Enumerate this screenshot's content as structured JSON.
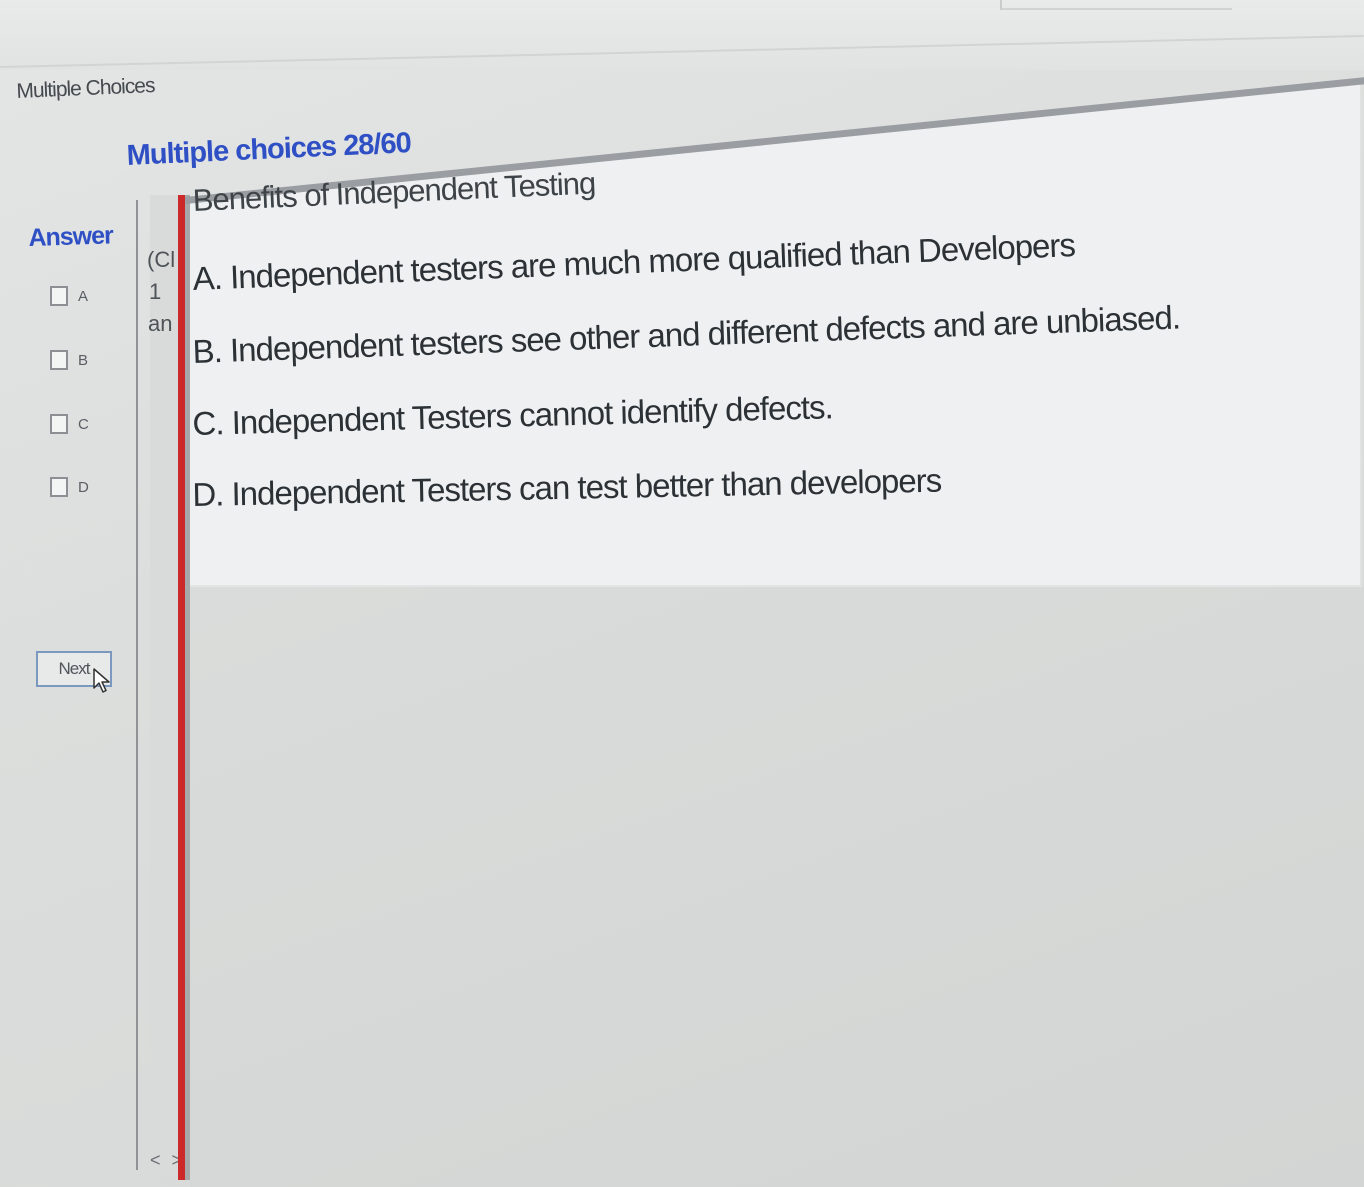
{
  "window": {
    "title": "Multiple Choices"
  },
  "quiz": {
    "heading": "Multiple choices 28/60",
    "question_title": "Benefits of Independent Testing",
    "options": [
      "A. Independent testers are much more qualified than Developers",
      "B. Independent testers see other and different defects and are unbiased.",
      "C. Independent Testers cannot identify defects.",
      "D. Independent Testers can test better than developers"
    ]
  },
  "answer": {
    "label": "Answer",
    "choices": [
      "A",
      "B",
      "C",
      "D"
    ],
    "next_label": "Next"
  },
  "side_fragments": {
    "line1": "(Cl",
    "line2": "1",
    "line3": "an"
  },
  "scroll": {
    "arrows": "< >"
  },
  "colors": {
    "accent_blue": "#2f4fc4",
    "divider_red": "#cc2a2a"
  },
  "icons": {
    "cursor": "mouse-pointer-icon"
  }
}
